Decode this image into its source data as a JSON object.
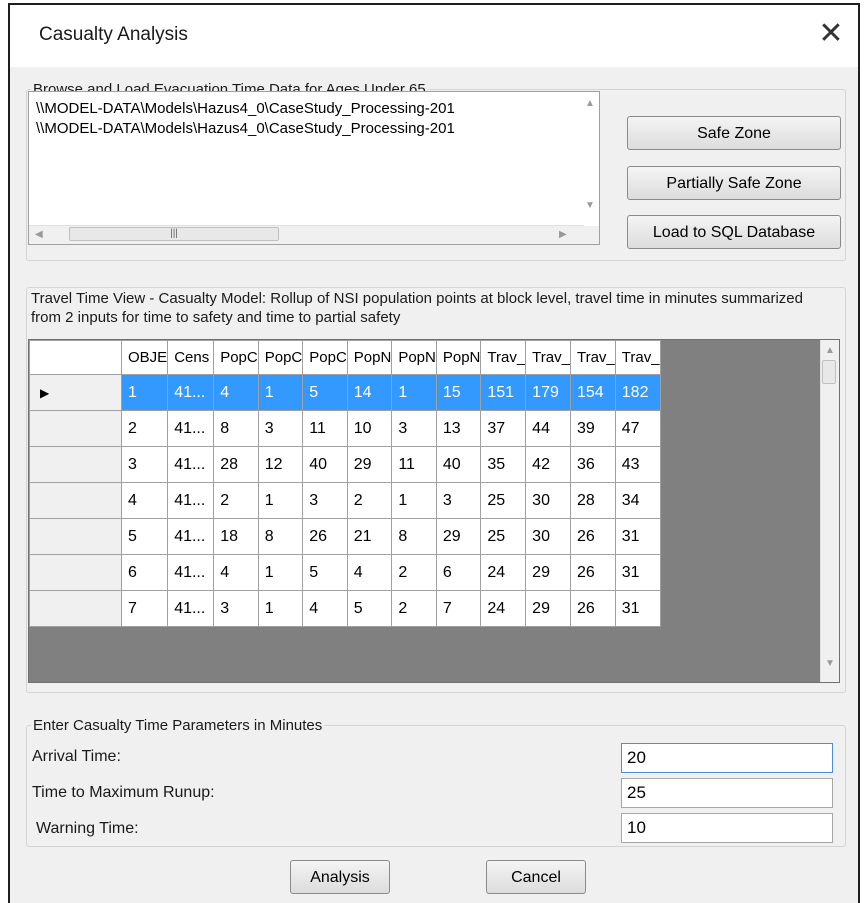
{
  "window": {
    "title": "Casualty Analysis"
  },
  "browse": {
    "legend": "Browse and Load Evacuation Time Data for Ages Under 65",
    "files": [
      "\\\\MODEL-DATA\\Models\\Hazus4_0\\CaseStudy_Processing-201",
      "\\\\MODEL-DATA\\Models\\Hazus4_0\\CaseStudy_Processing-201"
    ],
    "buttons": {
      "safe_zone": "Safe Zone",
      "partially_safe_zone": "Partially Safe Zone",
      "load_sql": "Load to SQL Database"
    }
  },
  "travel": {
    "description": "Travel Time View - Casualty Model: Rollup of NSI population points at block level, travel time in minutes summarized from 2 inputs for time to safety and time to partial safety",
    "columns": [
      "OBJE",
      "Cens",
      "PopC",
      "PopC",
      "PopC",
      "PopN",
      "PopN",
      "PopN",
      "Trav_",
      "Trav_",
      "Trav_",
      "Trav_"
    ],
    "rows": [
      [
        "1",
        "41...",
        "4",
        "1",
        "5",
        "14",
        "1",
        "15",
        "151",
        "179",
        "154",
        "182"
      ],
      [
        "2",
        "41...",
        "8",
        "3",
        "11",
        "10",
        "3",
        "13",
        "37",
        "44",
        "39",
        "47"
      ],
      [
        "3",
        "41...",
        "28",
        "12",
        "40",
        "29",
        "11",
        "40",
        "35",
        "42",
        "36",
        "43"
      ],
      [
        "4",
        "41...",
        "2",
        "1",
        "3",
        "2",
        "1",
        "3",
        "25",
        "30",
        "28",
        "34"
      ],
      [
        "5",
        "41...",
        "18",
        "8",
        "26",
        "21",
        "8",
        "29",
        "25",
        "30",
        "26",
        "31"
      ],
      [
        "6",
        "41...",
        "4",
        "1",
        "5",
        "4",
        "2",
        "6",
        "24",
        "29",
        "26",
        "31"
      ],
      [
        "7",
        "41...",
        "3",
        "1",
        "4",
        "5",
        "2",
        "7",
        "24",
        "29",
        "26",
        "31"
      ]
    ]
  },
  "params": {
    "legend": "Enter Casualty Time Parameters in Minutes",
    "arrival_label": "Arrival Time:",
    "arrival_value": "20",
    "runup_label": "Time to Maximum Runup:",
    "runup_value": "25",
    "warning_label": "Warning Time:",
    "warning_value": "10"
  },
  "actions": {
    "analysis": "Analysis",
    "cancel": "Cancel"
  },
  "colors": {
    "selection": "#3399ff",
    "dialog_bg": "#f0f0f0"
  }
}
